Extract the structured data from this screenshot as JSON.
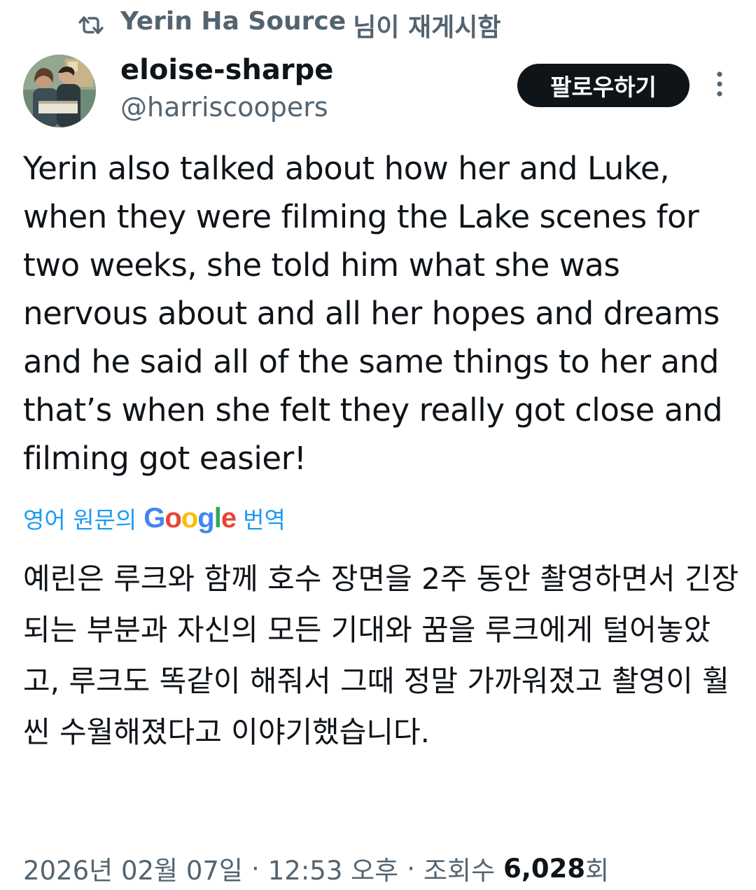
{
  "retweet": {
    "icon": "retweet-icon",
    "name": "Yerin Ha Source",
    "suffix": "님이 재게시함"
  },
  "author": {
    "avatar_icon": "avatar-photo",
    "name": "eloise-sharpe",
    "handle": "@harriscoopers"
  },
  "follow_button": {
    "label": "팔로우하기"
  },
  "more_icon": "more-vertical-icon",
  "tweet": {
    "text": "Yerin also talked about how her and Luke, when they were filming the Lake scenes for two weeks, she told him what she was nervous about and all her hopes and dreams and he said all of the same things to her and that’s when she felt they really got close and filming got easier!"
  },
  "translation": {
    "prefix": "영어 원문의",
    "brand": [
      "G",
      "o",
      "o",
      "g",
      "l",
      "e"
    ],
    "suffix": "번역",
    "text": "예린은 루크와 함께 호수 장면을 2주 동안 촬영하면서 긴장되는 부분과 자신의 모든 기대와 꿈을 루크에게 털어놓았고, 루크도 똑같이 해줘서 그때 정말 가까워졌고 촬영이 훨씬 수월해졌다고 이야기했습니다."
  },
  "meta": {
    "date": "2026년 02월 07일",
    "time": "12:53 오후",
    "views_label": "조회수",
    "views_count": "6,028",
    "views_unit": "회",
    "separator": "·"
  },
  "colors": {
    "text_primary": "#0f1419",
    "text_secondary": "#536471",
    "link_blue": "#1d9bf0",
    "google_blue": "#4285F4",
    "google_red": "#EA4335",
    "google_yellow": "#FBBC05",
    "google_green": "#34A853"
  }
}
